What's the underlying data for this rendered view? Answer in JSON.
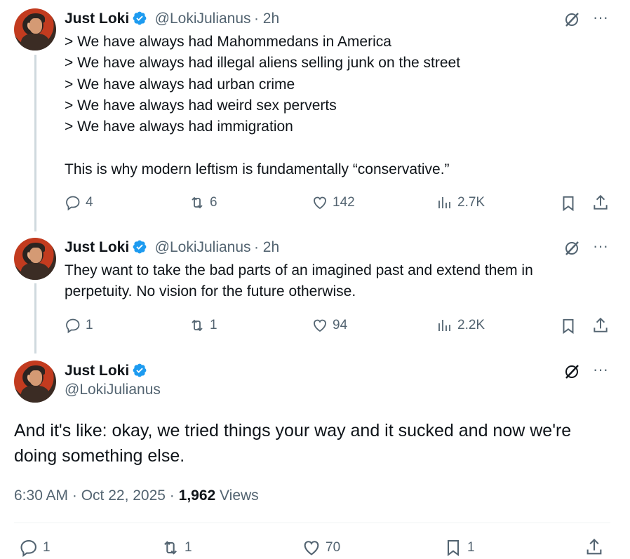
{
  "tweets": [
    {
      "name": "Just Loki",
      "handle": "@LokiJulianus",
      "time": "· 2h",
      "text": "> We have always had Mahommedans in America\n> We have always had illegal aliens selling junk on the street\n> We have always had urban crime\n> We have always had weird sex perverts\n> We have always had immigration\n\nThis is why modern leftism is fundamentally “conservative.”",
      "replies": "4",
      "reposts": "6",
      "likes": "142",
      "views": "2.7K"
    },
    {
      "name": "Just Loki",
      "handle": "@LokiJulianus",
      "time": "· 2h",
      "text": "They want to take the bad parts of an imagined past and extend them in\nperpetuity. No vision for the future otherwise.",
      "replies": "1",
      "reposts": "1",
      "likes": "94",
      "views": "2.2K"
    }
  ],
  "main_tweet": {
    "name": "Just Loki",
    "handle": "@LokiJulianus",
    "text": "And it's like: okay, we tried things your way and it sucked and now we're\ndoing something else.",
    "time": "6:30 AM · Oct 22, 2025 ·",
    "views_count": "1,962",
    "views_label": "Views",
    "replies": "1",
    "reposts": "1",
    "likes": "70",
    "bookmarks": "1"
  },
  "colors": {
    "verified": "#1d9bf0",
    "muted": "#536471",
    "line": "#cfd9de"
  }
}
